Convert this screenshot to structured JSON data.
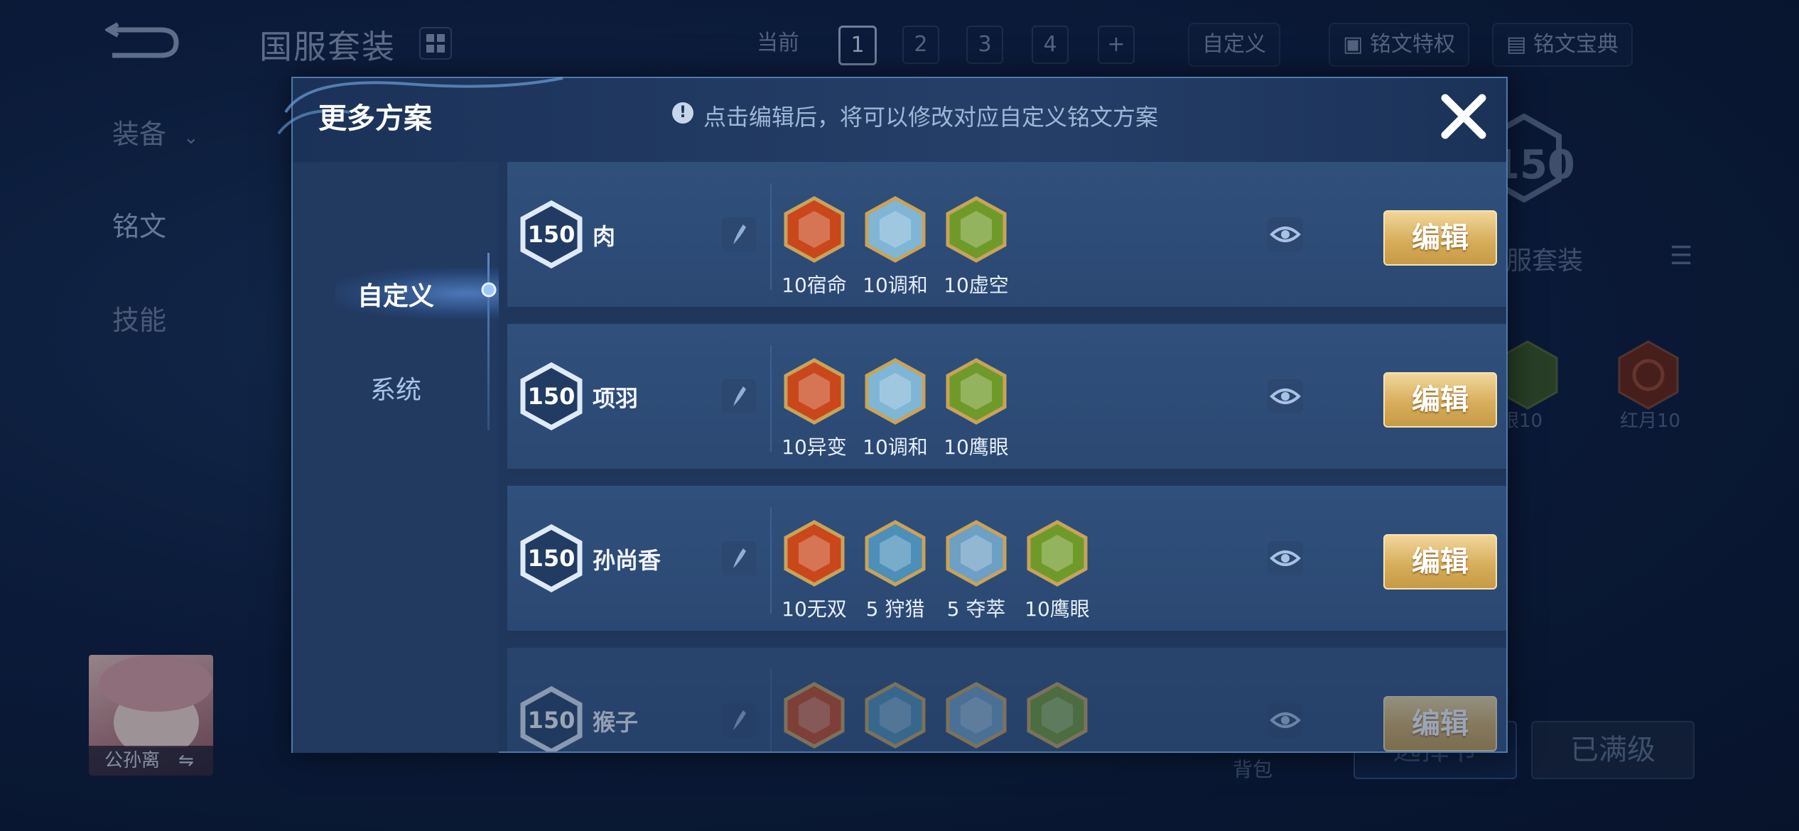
{
  "background": {
    "title": "国服套装",
    "page_tabs": {
      "current_label": "当前",
      "pages": [
        "1",
        "2",
        "3",
        "4"
      ],
      "add": "+",
      "custom": "自定义"
    },
    "chips": {
      "privilege": "铭文特权",
      "codex": "铭文宝典"
    },
    "side_nav": {
      "equipment": "装备",
      "rune": "铭文",
      "skill": "技能"
    },
    "card": {
      "level": "150",
      "name": "国服套装",
      "name_visible": "服套装"
    },
    "emblems": [
      {
        "label": "鹰眼10",
        "label_visible": "眼10"
      },
      {
        "label": "红月10"
      }
    ],
    "bag": "背包",
    "select_button": "选择节",
    "maxed_button": "已满级",
    "hero_name": "公孙离"
  },
  "modal": {
    "title": "更多方案",
    "hint": "点击编辑后，将可以修改对应自定义铭文方案",
    "hint_icon": "!",
    "tabs": [
      "自定义",
      "系统"
    ]
  },
  "plans": [
    {
      "level": "150",
      "name": "肉",
      "runes": [
        {
          "label": "10宿命",
          "color": "#c9471b"
        },
        {
          "label": "10调和",
          "color": "#7fb6d6"
        },
        {
          "label": "10虚空",
          "color": "#6f9a2a"
        }
      ],
      "edit": "编辑"
    },
    {
      "level": "150",
      "name": "项羽",
      "runes": [
        {
          "label": "10异变",
          "color": "#c9471b"
        },
        {
          "label": "10调和",
          "color": "#7fb6d6"
        },
        {
          "label": "10鹰眼",
          "color": "#6f9a2a"
        }
      ],
      "edit": "编辑"
    },
    {
      "level": "150",
      "name": "孙尚香",
      "runes": [
        {
          "label": "10无双",
          "color": "#c9471b"
        },
        {
          "label": "5 狩猎",
          "color": "#4c8fb8"
        },
        {
          "label": "5 夺萃",
          "color": "#6e9fc4"
        },
        {
          "label": "10鹰眼",
          "color": "#6f9a2a"
        }
      ],
      "edit": "编辑"
    },
    {
      "level": "150",
      "name": "猴子",
      "runes": [
        {
          "label": "",
          "color": "#c9471b"
        },
        {
          "label": "",
          "color": "#4c8fb8"
        },
        {
          "label": "",
          "color": "#6e9fc4"
        },
        {
          "label": "",
          "color": "#6f9a2a"
        }
      ],
      "edit": "编辑"
    }
  ]
}
